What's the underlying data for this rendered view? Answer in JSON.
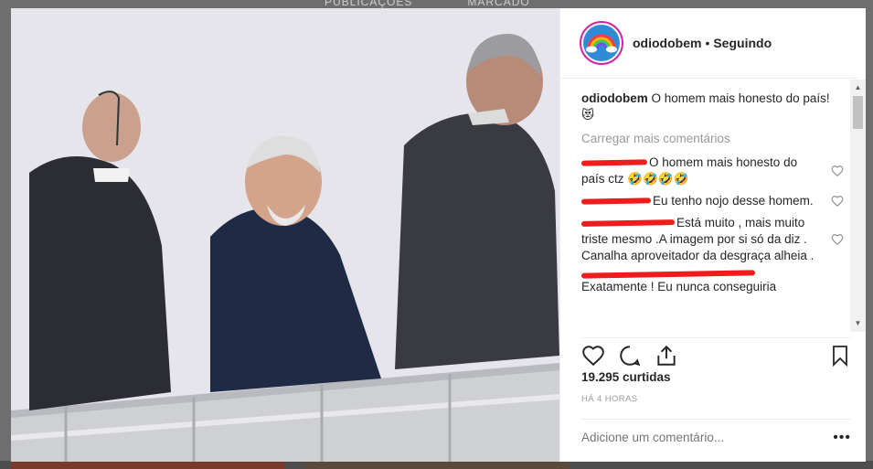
{
  "background": {
    "tabs": [
      "PUBLICAÇÕES",
      "MARCADO"
    ]
  },
  "post": {
    "username": "odiodobem",
    "separator": "•",
    "follow_status": "Seguindo",
    "caption_text": "O homem mais honesto do país! 😻",
    "load_more": "Carregar mais comentários",
    "comments": [
      {
        "text": "O homem mais honesto do país ctz 🤣🤣🤣🤣"
      },
      {
        "text": "Eu tenho nojo desse homem."
      },
      {
        "text": "Está muito , mais muito triste mesmo .A imagem por si só da diz . Canalha aproveitador da desgraça alheia ."
      },
      {
        "text": "Exatamente ! Eu nunca conseguiria"
      }
    ],
    "likes": "19.295 curtidas",
    "timestamp": "HÁ 4 HORAS",
    "comment_placeholder": "Adicione um comentário...",
    "more_label": "•••"
  },
  "icons": {
    "like": "heart-icon",
    "comment": "comment-icon",
    "share": "share-icon",
    "save": "bookmark-icon",
    "comment_like": "heart-outline-icon"
  },
  "colors": {
    "avatar_ring": "#d6249f",
    "redaction": "#ee1c1c",
    "muted_text": "#999999"
  }
}
